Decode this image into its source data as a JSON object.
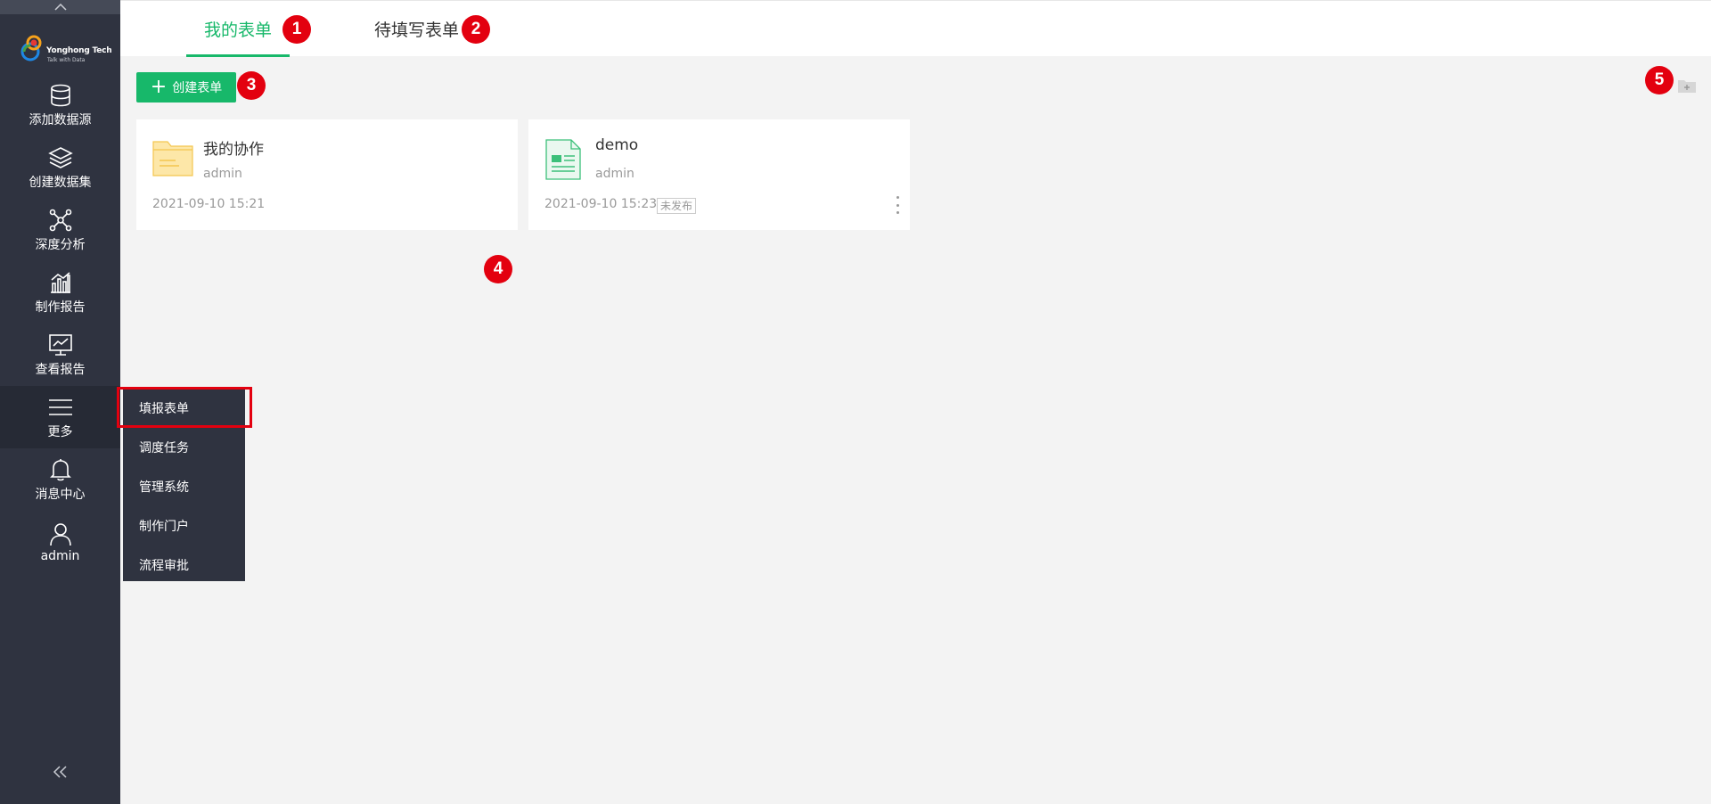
{
  "sidebar": {
    "brand": "Yonghong Tech",
    "slogan": "Talk with Data",
    "items": [
      {
        "label": "添加数据源",
        "icon": "database-icon"
      },
      {
        "label": "创建数据集",
        "icon": "layers-icon"
      },
      {
        "label": "深度分析",
        "icon": "network-icon"
      },
      {
        "label": "制作报告",
        "icon": "bar-chart-icon"
      },
      {
        "label": "查看报告",
        "icon": "monitor-chart-icon"
      },
      {
        "label": "更多",
        "icon": "menu-icon"
      },
      {
        "label": "消息中心",
        "icon": "bell-icon"
      },
      {
        "label": "admin",
        "icon": "user-icon"
      }
    ],
    "collapse_icon": "double-chevron-left-icon"
  },
  "tabs": [
    {
      "label": "我的表单",
      "active": true
    },
    {
      "label": "待填写表单",
      "active": false
    }
  ],
  "toolbar": {
    "create_label": "创建表单"
  },
  "cards": [
    {
      "title": "我的协作",
      "owner": "admin",
      "date": "2021-09-10 15:21",
      "type": "folder"
    },
    {
      "title": "demo",
      "owner": "admin",
      "date": "2021-09-10 15:23",
      "status": "未发布",
      "type": "form"
    }
  ],
  "more_menu": {
    "items": [
      "填报表单",
      "调度任务",
      "管理系统",
      "制作门户",
      "流程审批"
    ],
    "highlighted": "填报表单"
  },
  "callouts": [
    "1",
    "2",
    "3",
    "4",
    "5"
  ],
  "colors": {
    "sidebar_bg": "#2f3340",
    "accent": "#17b86a",
    "callout": "#e3000f",
    "folder": "#fbd87a"
  }
}
